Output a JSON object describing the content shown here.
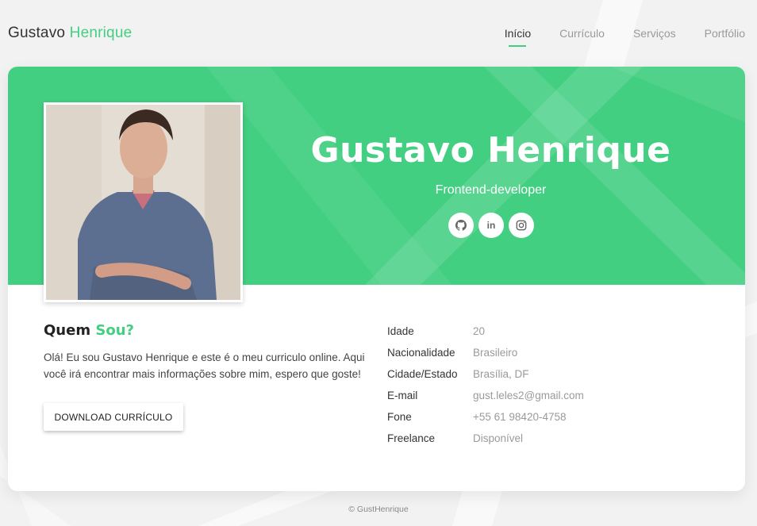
{
  "header": {
    "brand_first": "Gustavo",
    "brand_second": "Henrique",
    "nav": [
      {
        "label": "Início",
        "active": true
      },
      {
        "label": "Currículo",
        "active": false
      },
      {
        "label": "Serviços",
        "active": false
      },
      {
        "label": "Portfólio",
        "active": false
      }
    ]
  },
  "hero": {
    "name": "Gustavo Henrique",
    "role": "Frontend-developer",
    "socials": [
      {
        "icon": "github-icon"
      },
      {
        "icon": "linkedin-icon",
        "text": "in"
      },
      {
        "icon": "instagram-icon"
      }
    ]
  },
  "about": {
    "title_first": "Quem",
    "title_second": "Sou?",
    "text": "Olá! Eu sou Gustavo Henrique e este é o meu curriculo online. Aqui você irá encontrar mais informações sobre mim, espero que goste!",
    "button": "DOWNLOAD CURRÍCULO"
  },
  "info": [
    {
      "key": "Idade",
      "value": "20"
    },
    {
      "key": "Nacionalidade",
      "value": "Brasileiro"
    },
    {
      "key": "Cidade/Estado",
      "value": "Brasília, DF"
    },
    {
      "key": "E-mail",
      "value": "gust.leles2@gmail.com"
    },
    {
      "key": "Fone",
      "value": "+55 61 98420-4758"
    },
    {
      "key": "Freelance",
      "value": "Disponível"
    }
  ],
  "footer": "© GustHenrique",
  "colors": {
    "accent": "#43cf82",
    "background": "#f2f2f2"
  }
}
